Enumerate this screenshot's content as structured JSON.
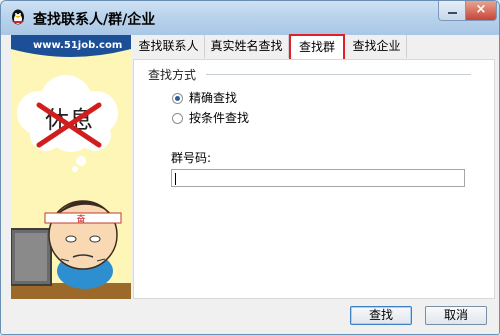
{
  "window": {
    "title": "查找联系人/群/企业",
    "close_label": "×"
  },
  "banner": {
    "logo_text": "www.51job.com"
  },
  "illustration": {
    "thought_text": "休息",
    "headband_text": "奋"
  },
  "tabs": [
    {
      "label": "查找联系人"
    },
    {
      "label": "真实姓名查找"
    },
    {
      "label": "查找群"
    },
    {
      "label": "查找企业"
    }
  ],
  "search_method": {
    "label": "查找方式",
    "options": [
      {
        "label": "精确查找",
        "checked": true
      },
      {
        "label": "按条件查找",
        "checked": false
      }
    ]
  },
  "group_number": {
    "label": "群号码:",
    "value": ""
  },
  "buttons": {
    "find": "查找",
    "cancel": "取消"
  },
  "colors": {
    "selected_tab_border": "#e0212b",
    "titlebar": "#b9d3ec"
  }
}
